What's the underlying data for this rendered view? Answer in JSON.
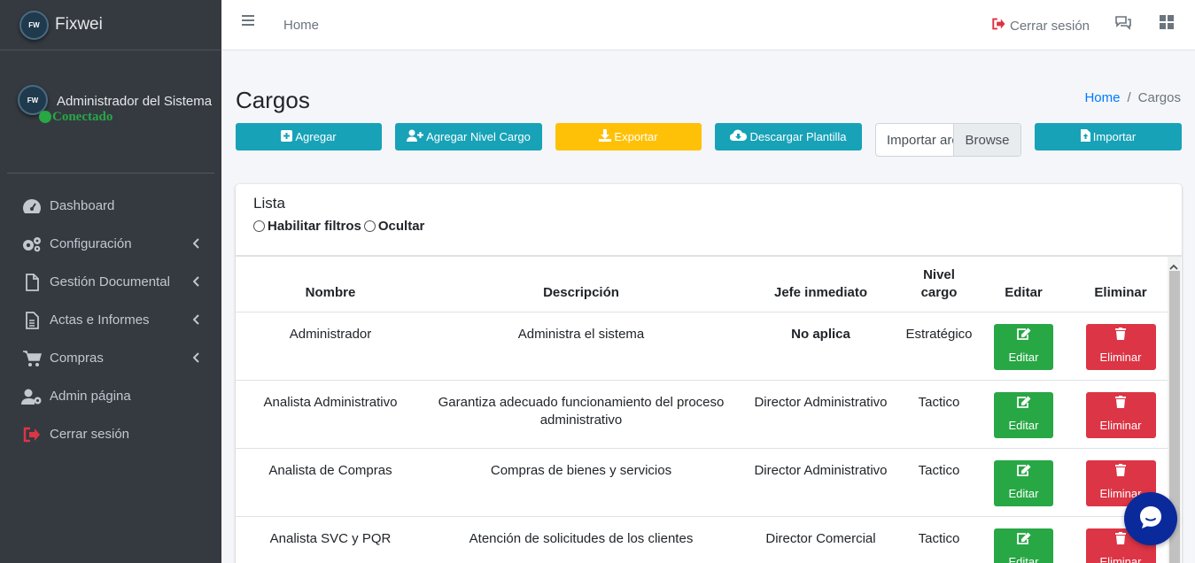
{
  "brand": {
    "logo_text": "FW",
    "name": "Fixwei"
  },
  "user": {
    "name": "Administrador del Sistema",
    "status": "Conectado"
  },
  "sidebar": {
    "items": [
      {
        "label": "Dashboard",
        "icon": "tachometer-icon",
        "has_submenu": false
      },
      {
        "label": "Configuración",
        "icon": "cogs-icon",
        "has_submenu": true
      },
      {
        "label": "Gestión Documental",
        "icon": "file-icon",
        "has_submenu": true
      },
      {
        "label": "Actas e Informes",
        "icon": "file-text-icon",
        "has_submenu": true
      },
      {
        "label": "Compras",
        "icon": "cart-icon",
        "has_submenu": true
      },
      {
        "label": "Admin página",
        "icon": "user-cog-icon",
        "has_submenu": false
      },
      {
        "label": "Cerrar sesión",
        "icon": "sign-out-icon",
        "has_submenu": false
      }
    ]
  },
  "topbar": {
    "home_label": "Home",
    "logout_label": "Cerrar sesión"
  },
  "page": {
    "title": "Cargos",
    "breadcrumb": {
      "home": "Home",
      "separator": "/",
      "current": "Cargos"
    }
  },
  "actions": {
    "add": "Agregar",
    "add_level": "Agregar Nivel Cargo",
    "export": "Exportar",
    "download_template": "Descargar Plantilla",
    "file_placeholder": "Importar archivo",
    "browse": "Browse",
    "import": "Importar"
  },
  "list": {
    "title": "Lista",
    "filter_enable": "Habilitar filtros",
    "filter_hide": "Ocultar",
    "columns": [
      "Nombre",
      "Descripción",
      "Jefe inmediato",
      "Nivel cargo",
      "Editar",
      "Eliminar"
    ],
    "edit_label": "Editar",
    "delete_label": "Eliminar",
    "rows": [
      {
        "nombre": "Administrador",
        "descripcion": "Administra el sistema",
        "jefe": "No aplica",
        "jefe_bold": true,
        "nivel": "Estratégico"
      },
      {
        "nombre": "Analista Administrativo",
        "descripcion": "Garantiza adecuado funcionamiento del proceso administrativo",
        "jefe": "Director Administrativo",
        "jefe_bold": false,
        "nivel": "Tactico"
      },
      {
        "nombre": "Analista de Compras",
        "descripcion": "Compras de bienes y servicios",
        "jefe": "Director Administrativo",
        "jefe_bold": false,
        "nivel": "Tactico"
      },
      {
        "nombre": "Analista SVC y PQR",
        "descripcion": "Atención de solicitudes de los clientes",
        "jefe": "Director Comercial",
        "jefe_bold": false,
        "nivel": "Tactico"
      }
    ]
  },
  "colors": {
    "sidebar": "#343a40",
    "info": "#17a2b8",
    "warning": "#ffc107",
    "success": "#28a745",
    "danger": "#dc3545",
    "link": "#007bff"
  }
}
